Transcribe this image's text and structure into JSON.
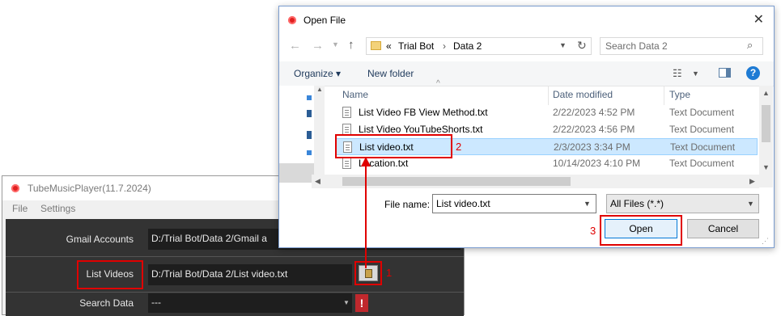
{
  "app": {
    "title": "TubeMusicPlayer(11.7.2024)",
    "menu": [
      "File",
      "Settings"
    ],
    "rows": [
      {
        "label": "Gmail Accounts",
        "value": "D:/Trial Bot/Data 2/Gmail a"
      },
      {
        "label": "List Videos",
        "value": "D:/Trial Bot/Data 2/List video.txt"
      },
      {
        "label": "Search Data",
        "value": "---"
      }
    ],
    "warning_symbol": "!"
  },
  "dialog": {
    "title": "Open File",
    "close_symbol": "✕",
    "address": {
      "overflow": "«",
      "crumbs": [
        "Trial Bot",
        "Data 2"
      ]
    },
    "search_placeholder": "Search Data 2",
    "organize_label": "Organize ▾",
    "new_folder_label": "New folder",
    "columns": {
      "name": "Name",
      "date": "Date modified",
      "type": "Type"
    },
    "files": [
      {
        "name": "List Video FB View Method.txt",
        "date": "2/22/2023 4:52 PM",
        "type": "Text Document"
      },
      {
        "name": "List Video YouTubeShorts.txt",
        "date": "2/22/2023 4:56 PM",
        "type": "Text Document"
      },
      {
        "name": "List video.txt",
        "date": "2/3/2023 3:34 PM",
        "type": "Text Document",
        "selected": true
      },
      {
        "name": "Location.txt",
        "date": "10/14/2023 4:10 PM",
        "type": "Text Document"
      }
    ],
    "filename_label": "File name:",
    "filename_value": "List video.txt",
    "filter_value": "All Files (*.*)",
    "open_label": "Open",
    "cancel_label": "Cancel"
  },
  "annotations": {
    "step1": "1",
    "step2": "2",
    "step3": "3"
  },
  "colors": {
    "highlight": "#e00000",
    "selection": "#cce8ff",
    "app_panel": "#333333"
  }
}
